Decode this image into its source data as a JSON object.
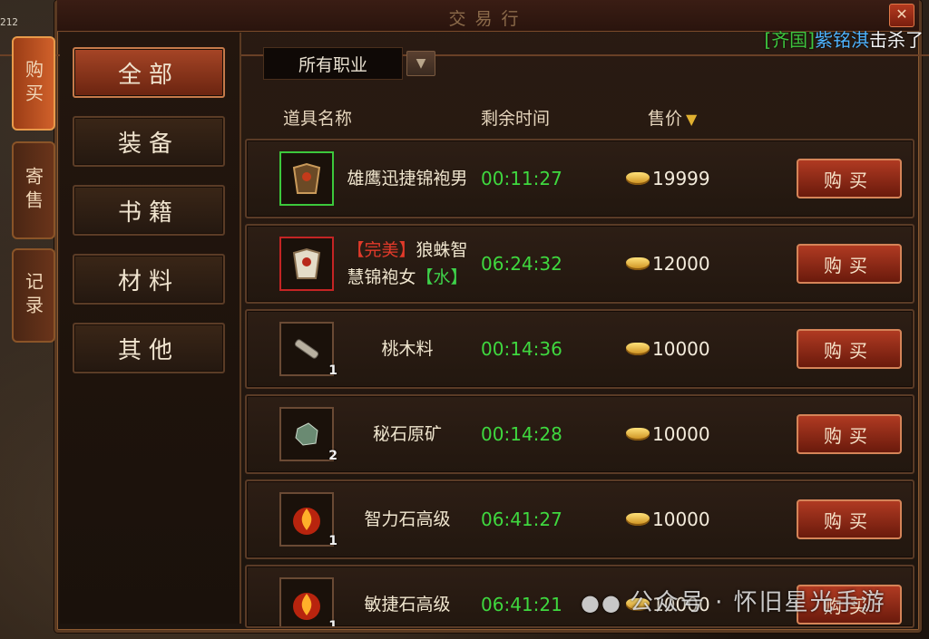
{
  "window": {
    "title": "交易行",
    "close_label": "✕"
  },
  "corner_number": "212",
  "killfeed": {
    "bracket_open": "[",
    "faction": "齐国",
    "bracket_close": "]",
    "player": "紫铭淇",
    "action": "击杀了"
  },
  "side_tabs": [
    {
      "label": "购买",
      "active": true
    },
    {
      "label": "寄售",
      "active": false
    },
    {
      "label": "记录",
      "active": false
    }
  ],
  "categories": [
    {
      "label": "全部",
      "active": true
    },
    {
      "label": "装备",
      "active": false
    },
    {
      "label": "书籍",
      "active": false
    },
    {
      "label": "材料",
      "active": false
    },
    {
      "label": "其他",
      "active": false
    }
  ],
  "filter": {
    "selected": "所有职业"
  },
  "columns": {
    "name": "道具名称",
    "time": "剩余时间",
    "price": "售价"
  },
  "items": [
    {
      "name": "雄鹰迅捷锦袍男",
      "tag": "",
      "tag2": "",
      "time": "00:11:27",
      "price": "19999",
      "qty": "",
      "icon": "robe-icon",
      "frame": "green",
      "buy": "购买"
    },
    {
      "name": "狼蛛智慧锦袍女",
      "tag": "【完美】",
      "tag2": "【水】",
      "time": "06:24:32",
      "price": "12000",
      "qty": "",
      "icon": "robe-icon",
      "frame": "red",
      "buy": "购买"
    },
    {
      "name": "桃木料",
      "tag": "",
      "tag2": "",
      "time": "00:14:36",
      "price": "10000",
      "qty": "1",
      "icon": "wood-icon",
      "frame": "normal",
      "buy": "购买"
    },
    {
      "name": "秘石原矿",
      "tag": "",
      "tag2": "",
      "time": "00:14:28",
      "price": "10000",
      "qty": "2",
      "icon": "ore-icon",
      "frame": "normal",
      "buy": "购买"
    },
    {
      "name": "智力石高级",
      "tag": "",
      "tag2": "",
      "time": "06:41:27",
      "price": "10000",
      "qty": "1",
      "icon": "fire-stone-icon",
      "frame": "normal",
      "buy": "购买"
    },
    {
      "name": "敏捷石高级",
      "tag": "",
      "tag2": "",
      "time": "06:41:21",
      "price": "10000",
      "qty": "1",
      "icon": "fire-stone-icon",
      "frame": "normal",
      "buy": "购买"
    }
  ],
  "watermark": "公众号 · 怀旧星光手游"
}
